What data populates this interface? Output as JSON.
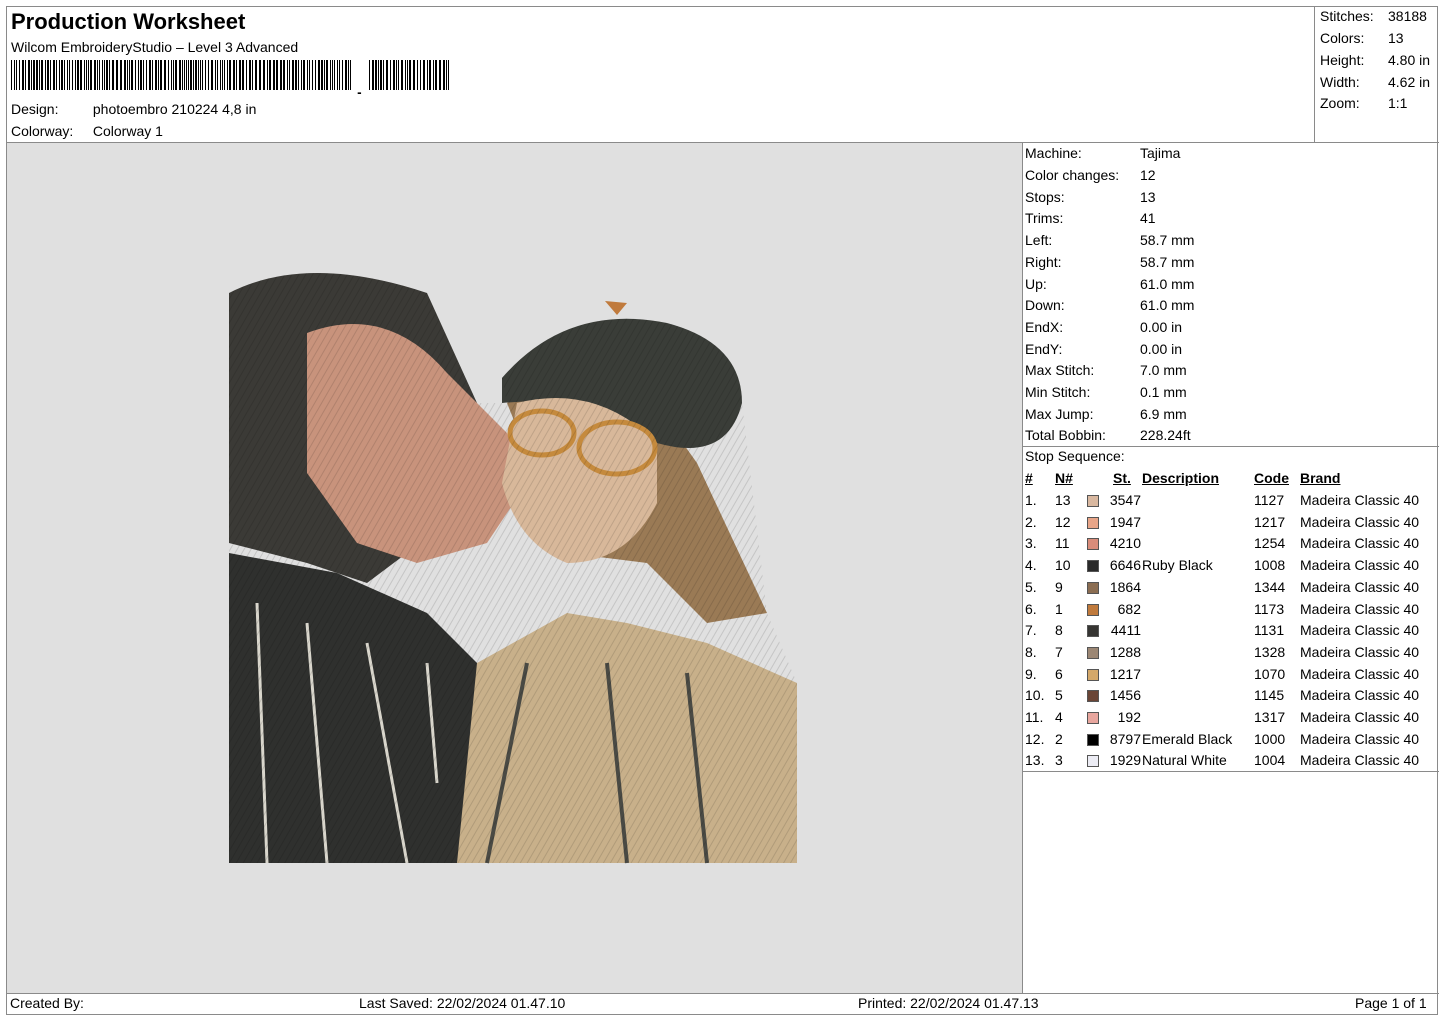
{
  "header": {
    "title": "Production Worksheet",
    "software": "Wilcom EmbroideryStudio – Level 3 Advanced",
    "barcode_trailing": ",",
    "design_label": "Design:",
    "design_value": "photoembro 210224 4,8 in",
    "colorway_label": "Colorway:",
    "colorway_value": "Colorway 1"
  },
  "stats": [
    {
      "label": "Stitches:",
      "value": "38188"
    },
    {
      "label": "Colors:",
      "value": "13"
    },
    {
      "label": "Height:",
      "value": "4.80 in"
    },
    {
      "label": "Width:",
      "value": "4.62 in"
    },
    {
      "label": "Zoom:",
      "value": "1:1"
    }
  ],
  "machine_info": [
    {
      "label": "Machine:",
      "value": "Tajima"
    },
    {
      "label": "Color changes:",
      "value": "12"
    },
    {
      "label": "Stops:",
      "value": "13"
    },
    {
      "label": "Trims:",
      "value": "41"
    },
    {
      "label": "Left:",
      "value": "58.7 mm"
    },
    {
      "label": "Right:",
      "value": "58.7 mm"
    },
    {
      "label": "Up:",
      "value": "61.0 mm"
    },
    {
      "label": "Down:",
      "value": "61.0 mm"
    },
    {
      "label": "EndX:",
      "value": "0.00 in"
    },
    {
      "label": "EndY:",
      "value": "0.00 in"
    },
    {
      "label": "Max Stitch:",
      "value": "7.0 mm"
    },
    {
      "label": "Min Stitch:",
      "value": "0.1 mm"
    },
    {
      "label": "Max Jump:",
      "value": "6.9 mm"
    },
    {
      "label": "Total Bobbin:",
      "value": "228.24ft"
    }
  ],
  "stop_sequence": {
    "title": "Stop Sequence:",
    "headers": {
      "num": "#",
      "n": "N#",
      "st": "St.",
      "desc": "Description",
      "code": "Code",
      "brand": "Brand"
    },
    "rows": [
      {
        "num": "1.",
        "n": "13",
        "st": "3547",
        "color": "#d9b8a0",
        "desc": "",
        "code": "1127",
        "brand": "Madeira Classic 40"
      },
      {
        "num": "2.",
        "n": "12",
        "st": "1947",
        "color": "#e8a588",
        "desc": "",
        "code": "1217",
        "brand": "Madeira Classic 40"
      },
      {
        "num": "3.",
        "n": "11",
        "st": "4210",
        "color": "#d98c7a",
        "desc": "",
        "code": "1254",
        "brand": "Madeira Classic 40"
      },
      {
        "num": "4.",
        "n": "10",
        "st": "6646",
        "color": "#2a2a2a",
        "desc": "Ruby Black",
        "code": "1008",
        "brand": "Madeira Classic 40"
      },
      {
        "num": "5.",
        "n": "9",
        "st": "1864",
        "color": "#8b6d52",
        "desc": "",
        "code": "1344",
        "brand": "Madeira Classic 40"
      },
      {
        "num": "6.",
        "n": "1",
        "st": "682",
        "color": "#c07a3c",
        "desc": "",
        "code": "1173",
        "brand": "Madeira Classic 40"
      },
      {
        "num": "7.",
        "n": "8",
        "st": "4411",
        "color": "#363532",
        "desc": "",
        "code": "1131",
        "brand": "Madeira Classic 40"
      },
      {
        "num": "8.",
        "n": "7",
        "st": "1288",
        "color": "#9c8774",
        "desc": "",
        "code": "1328",
        "brand": "Madeira Classic 40"
      },
      {
        "num": "9.",
        "n": "6",
        "st": "1217",
        "color": "#d4a86a",
        "desc": "",
        "code": "1070",
        "brand": "Madeira Classic 40"
      },
      {
        "num": "10.",
        "n": "5",
        "st": "1456",
        "color": "#6a4536",
        "desc": "",
        "code": "1145",
        "brand": "Madeira Classic 40"
      },
      {
        "num": "11.",
        "n": "4",
        "st": "192",
        "color": "#e8a69e",
        "desc": "",
        "code": "1317",
        "brand": "Madeira Classic 40"
      },
      {
        "num": "12.",
        "n": "2",
        "st": "8797",
        "color": "#000000",
        "desc": "Emerald Black",
        "code": "1000",
        "brand": "Madeira Classic 40"
      },
      {
        "num": "13.",
        "n": "3",
        "st": "1929",
        "color": "#ececf4",
        "desc": "Natural White",
        "code": "1004",
        "brand": "Madeira Classic 40"
      }
    ]
  },
  "footer": {
    "created": "Created By:",
    "saved": "Last Saved: 22/02/2024 01.47.10",
    "printed": "Printed: 22/02/2024 01.47.13",
    "page": "Page 1 of 1"
  }
}
